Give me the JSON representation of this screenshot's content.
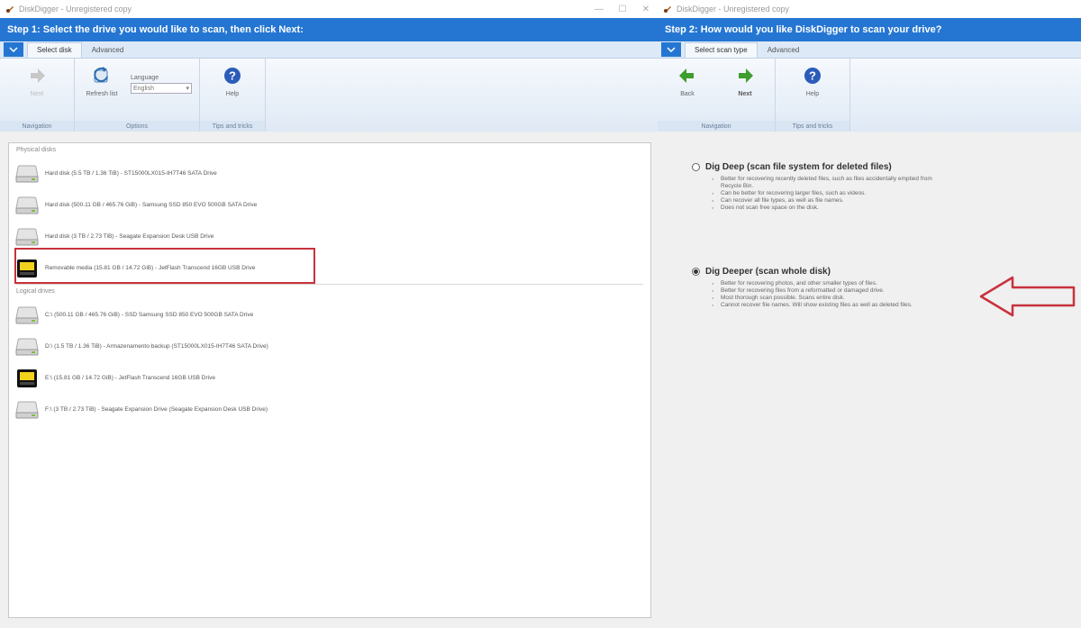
{
  "left": {
    "title": "DiskDigger - Unregistered copy",
    "header": "Step 1: Select the drive you would like to scan, then click Next:",
    "tabs": [
      "Select disk",
      "Advanced"
    ],
    "ribbon": {
      "next_label": "Next",
      "refresh_label": "Refresh list",
      "language_label": "Language",
      "language_value": "English",
      "help_label": "Help",
      "group_navigation": "Navigation",
      "group_options": "Options",
      "group_tips": "Tips and tricks"
    },
    "physical_title": "Physical disks",
    "physical": [
      {
        "label": "Hard disk (5.5 TB / 1.36 TiB) - ST15000LX015-IH7T46 SATA Drive",
        "icon": "hdd"
      },
      {
        "label": "Hard disk (500.11 GB / 465.76 GiB) - Samsung SSD 850 EVO 500GB SATA Drive",
        "icon": "hdd"
      },
      {
        "label": "Hard disk (3 TB / 2.73 TiB) - Seagate Expansion Desk USB Drive",
        "icon": "hdd"
      },
      {
        "label": "Removable media (15.81 GB / 14.72 GiB) - JetFlash Transcend 16GB USB Drive",
        "icon": "usb"
      }
    ],
    "logical_title": "Logical drives",
    "logical": [
      {
        "label": "C:\\ (500.11 GB / 465.76 GiB) - SSD Samsung SSD 850 EVO 500GB SATA Drive",
        "icon": "hdd"
      },
      {
        "label": "D:\\ (1.5 TB / 1.36 TiB) - Armazenamento backup (ST15000LX015-IH7T46 SATA Drive)",
        "icon": "hdd"
      },
      {
        "label": "E:\\ (15.81 GB / 14.72 GiB) - JetFlash Transcend 16GB USB Drive",
        "icon": "usb"
      },
      {
        "label": "F:\\ (3 TB / 2.73 TiB) - Seagate Expansion Drive (Seagate Expansion Desk USB Drive)",
        "icon": "hdd"
      }
    ]
  },
  "right": {
    "title": "DiskDigger - Unregistered copy",
    "header": "Step 2: How would you like DiskDigger to scan your drive?",
    "tabs": [
      "Select scan type",
      "Advanced"
    ],
    "ribbon": {
      "back_label": "Back",
      "next_label": "Next",
      "help_label": "Help",
      "group_navigation": "Navigation",
      "group_tips": "Tips and tricks"
    },
    "options": [
      {
        "title": "Dig Deep (scan file system for deleted files)",
        "selected": false,
        "bullets": [
          "Better for recovering recently deleted files, such as files accidentally emptied from Recycle Bin.",
          "Can be better for recovering larger files, such as videos.",
          "Can recover all file types, as well as file names.",
          "Does not scan free space on the disk."
        ]
      },
      {
        "title": "Dig Deeper (scan whole disk)",
        "selected": true,
        "bullets": [
          "Better for recovering photos, and other smaller types of files.",
          "Better for recovering files from a reformatted or damaged drive.",
          "Most thorough scan possible. Scans entire disk.",
          "Cannot recover file names. Will show existing files as well as deleted files."
        ]
      }
    ]
  },
  "colors": {
    "accent": "#2576d2",
    "highlight": "#c8323c"
  }
}
